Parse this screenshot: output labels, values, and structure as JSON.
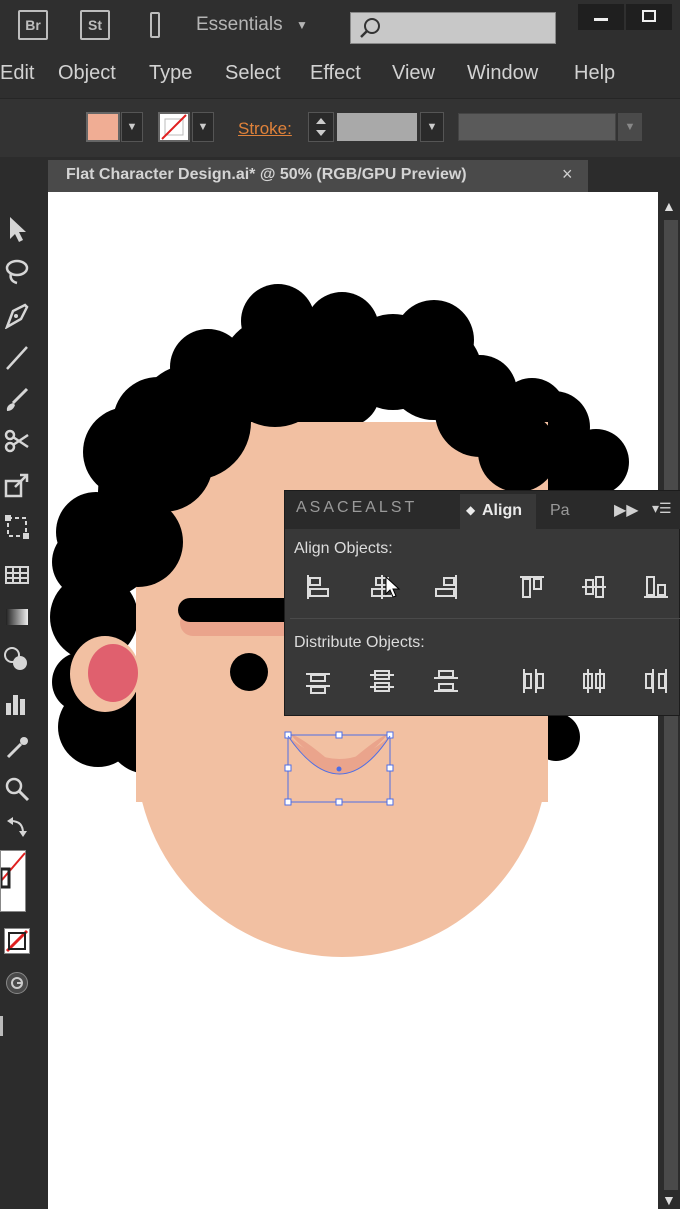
{
  "app": {
    "bridge_label": "Br",
    "stock_label": "St",
    "workspace": "Essentials"
  },
  "menu": [
    "Edit",
    "Object",
    "Type",
    "Select",
    "Effect",
    "View",
    "Window",
    "Help"
  ],
  "control_bar": {
    "fill_color": "#f0ad94",
    "stroke_label": "Stroke:"
  },
  "document": {
    "title": "Flat Character Design.ai* @ 50% (RGB/GPU Preview)",
    "close_glyph": "×"
  },
  "colors": {
    "skin": "#f2c0a2",
    "hair": "#000000",
    "ear_inner": "#e0606e",
    "mouth": "#eaa48c",
    "eyebrow_shadow": "#eaa48c",
    "selection": "#4d6ee6",
    "stroke_label": "#e0823a"
  },
  "align_panel": {
    "collapsed_tabs": "ASACEALST",
    "active_tab": "Align",
    "other_tab": "Pa",
    "align_objects_label": "Align Objects:",
    "distribute_objects_label": "Distribute Objects:"
  }
}
